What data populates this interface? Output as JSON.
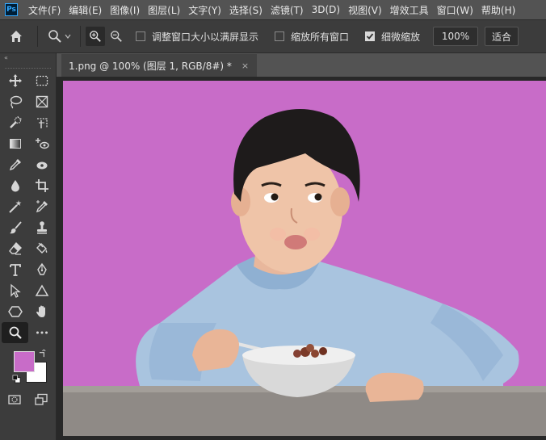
{
  "app": {
    "logo": "Ps"
  },
  "menu": [
    "文件(F)",
    "编辑(E)",
    "图像(I)",
    "图层(L)",
    "文字(Y)",
    "选择(S)",
    "滤镜(T)",
    "3D(D)",
    "视图(V)",
    "增效工具",
    "窗口(W)",
    "帮助(H)"
  ],
  "options": {
    "resize_windows": "调整窗口大小以满屏显示",
    "zoom_all_windows": "缩放所有窗口",
    "scrubby_zoom": "细微缩放",
    "scrubby_checked": true,
    "zoom_value": "100%",
    "fit_screen": "适合"
  },
  "document": {
    "tab_title": "1.png @ 100% (图层 1, RGB/8#) *",
    "close": "×"
  },
  "toolbar": {
    "collapse": "«"
  },
  "colors": {
    "foreground": "#c86cc8",
    "background": "#ffffff",
    "canvas_bg": "#c86cc8"
  },
  "image": {
    "alt": "child sitting at table with cereal bowl and spoon on purple background"
  }
}
